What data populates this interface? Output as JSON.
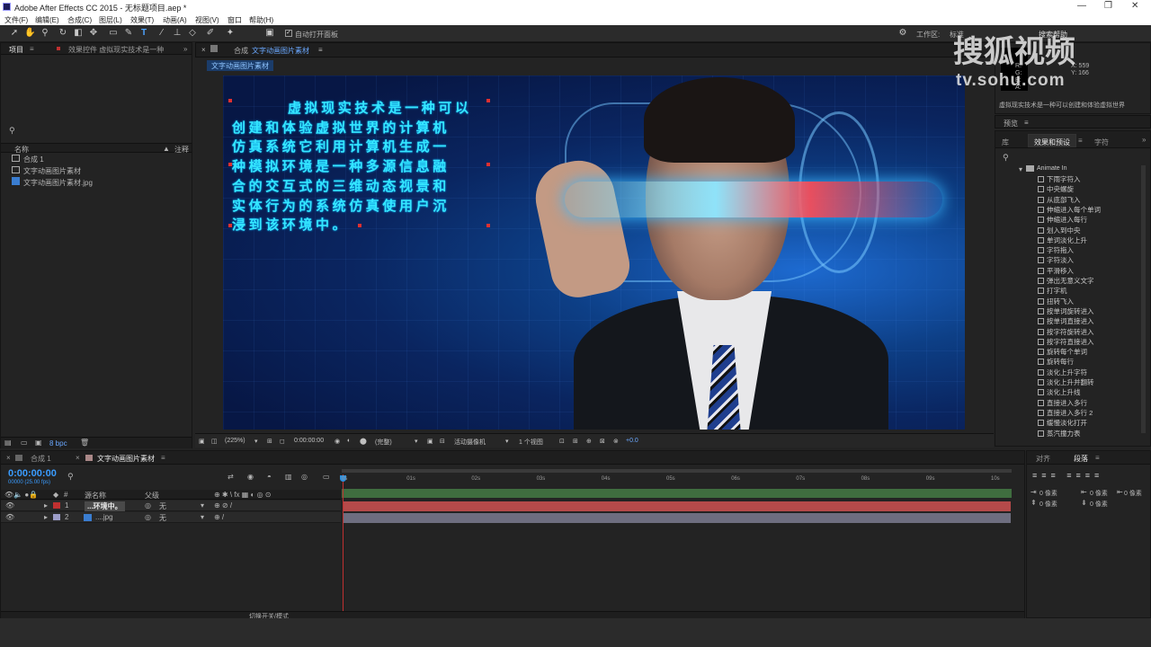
{
  "window": {
    "title": "Adobe After Effects CC 2015 - 无标题项目.aep *",
    "controls": [
      "—",
      "❐",
      "✕"
    ]
  },
  "menu": [
    "文件(F)",
    "编辑(E)",
    "合成(C)",
    "图层(L)",
    "效果(T)",
    "动画(A)",
    "视图(V)",
    "窗口",
    "帮助(H)"
  ],
  "toolbar": {
    "auto_open": "自动打开面板",
    "workspace_label": "工作区:",
    "workspace_value": "标准",
    "search_help": "搜索帮助"
  },
  "project": {
    "tab": "项目",
    "effect_controls_tab": "效果控件 虚拟现实技术是一种",
    "search_icon": "search-icon",
    "col_name": "名称",
    "col_comment": "注释",
    "items": [
      "合成 1",
      "文字动画图片素材",
      "文字动画图片素材.jpg"
    ],
    "bpc": "8 bpc"
  },
  "composition": {
    "tab_prefix": "合成",
    "tab_name": "文字动画图片素材",
    "subtab": "文字动画图片素材"
  },
  "overlay_text": [
    "虚拟现实技术是一种可以",
    "创建和体验虚拟世界的计算机",
    "仿真系统它利用计算机生成一",
    "种模拟环境是一种多源信息融",
    "合的交互式的三维动态视景和",
    "实体行为的系统仿真使用户沉",
    "浸到该环境中。"
  ],
  "viewer_status": {
    "zoom": "(225%)",
    "timecode": "0:00:00:00",
    "quality": "(完整)",
    "camera": "活动摄像机",
    "views": "1 个视图",
    "exposure": "+0.0"
  },
  "info": {
    "r": "R:",
    "g": "G:",
    "b": "B:",
    "a": "A:",
    "x": "X: 559",
    "y": "Y: 166",
    "message": "虚拟现实技术是一种可以创建和体验虚拟世界"
  },
  "preview_tab": "预览",
  "effects": {
    "tabs": [
      "库",
      "效果和预设",
      "字符"
    ],
    "folder": "Animate In",
    "items": [
      "下雨字符入",
      "中央螺旋",
      "从底部飞入",
      "伸缩进入每个单词",
      "伸缩进入每行",
      "划入到中央",
      "单词淡化上升",
      "字符拖入",
      "字符淡入",
      "平滑移入",
      "弹出无意义文字",
      "打字机",
      "扭转飞入",
      "按单词旋转进入",
      "按单词直接进入",
      "按字符旋转进入",
      "按字符直接进入",
      "旋转每个单词",
      "旋转每行",
      "淡化上升字符",
      "淡化上升并翻转",
      "淡化上升线",
      "直接进入多行",
      "直接进入多行 2",
      "缓慢淡化打开",
      "蒸汽撞力表"
    ]
  },
  "timeline": {
    "tabs": [
      "合成 1",
      "文字动画图片素材"
    ],
    "timecode": "0:00:00:00",
    "fps": "00000 (25.00 fps)",
    "col_source": "源名称",
    "col_parent": "父级",
    "layers": [
      {
        "num": "1",
        "name": "...环境中。",
        "parent": "无"
      },
      {
        "num": "2",
        "name": "....jpg",
        "parent": "无"
      }
    ],
    "ticks": [
      "0s",
      "01s",
      "02s",
      "03s",
      "04s",
      "05s",
      "06s",
      "07s",
      "08s",
      "09s",
      "10s"
    ],
    "switch_mode": "切换开关/模式"
  },
  "paragraph": {
    "tabs": [
      "对齐",
      "段落"
    ],
    "indent_values": [
      "0 像素",
      "0 像素",
      "0 像素",
      "0 像素",
      "0 像素"
    ]
  },
  "watermark": {
    "brand": "搜狐视频",
    "url": "tv.sohu.com"
  },
  "colors": {
    "overlay_text": "#35e6ff",
    "layer1_bar": "#b54a4a",
    "layer2_bar": "#6e6e80",
    "playhead": "#2f8fdc",
    "timecode": "#3a9cff"
  }
}
